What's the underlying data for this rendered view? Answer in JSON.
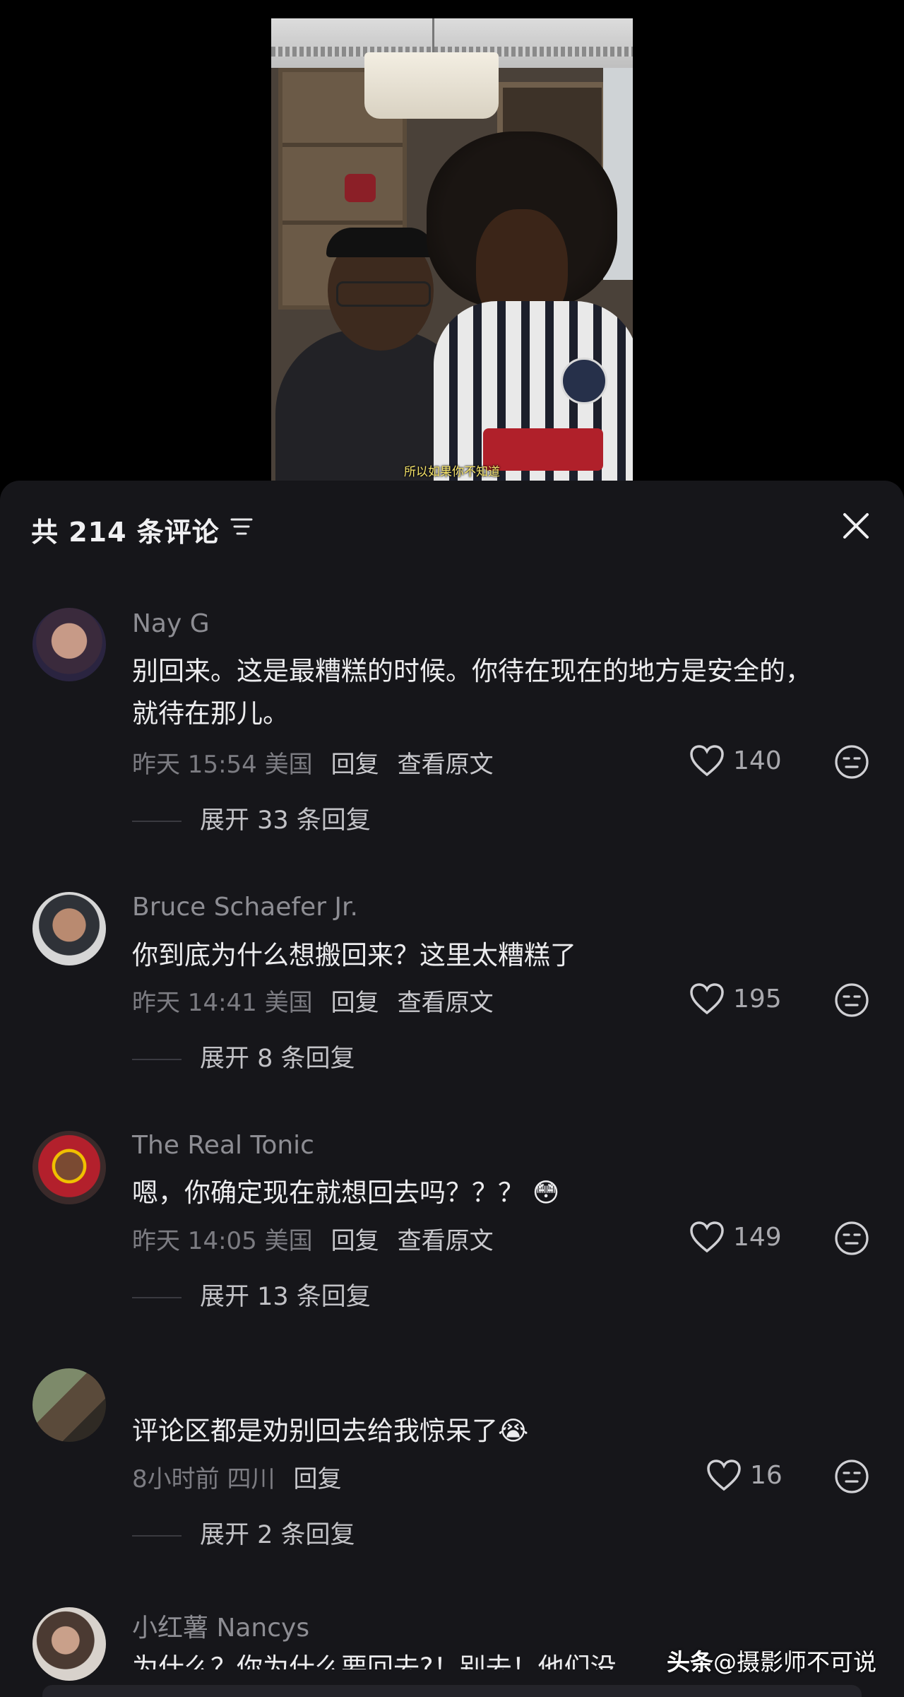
{
  "video": {
    "caption": "所以如果你不知道"
  },
  "sheet": {
    "title": "共 214 条评论"
  },
  "comments": [
    {
      "author": "Nay G",
      "text": "别回来。这是最糟糕的时候。你待在现在的地方是安全的，就待在那儿。",
      "time": "昨天 15:54 美国",
      "reply": "回复",
      "original": "查看原文",
      "likes": "140",
      "expand": "展开 33 条回复"
    },
    {
      "author": "Bruce Schaefer Jr.",
      "text": "你到底为什么想搬回来？这里太糟糕了",
      "time": "昨天 14:41 美国",
      "reply": "回复",
      "original": "查看原文",
      "likes": "195",
      "expand": "展开 8 条回复"
    },
    {
      "author": "The Real Tonic",
      "text": "嗯，你确定现在就想回去吗？？？ 😳",
      "time": "昨天 14:05 美国",
      "reply": "回复",
      "original": "查看原文",
      "likes": "149",
      "expand": "展开 13 条回复"
    },
    {
      "author": "",
      "text": "评论区都是劝别回去给我惊呆了😭",
      "time": "8小时前 四川",
      "reply": "回复",
      "likes": "16",
      "expand": "展开 2 条回复"
    },
    {
      "author": "小红薯 Nancys",
      "text": "为什么？你为什么要回去?！别去！他们没"
    }
  ],
  "watermark": {
    "brand": "头条",
    "handle": "@摄影师不可说"
  },
  "colors": {
    "sheet_bg": "#16161a",
    "page_bg": "#000000",
    "caption": "#f5e36a"
  }
}
